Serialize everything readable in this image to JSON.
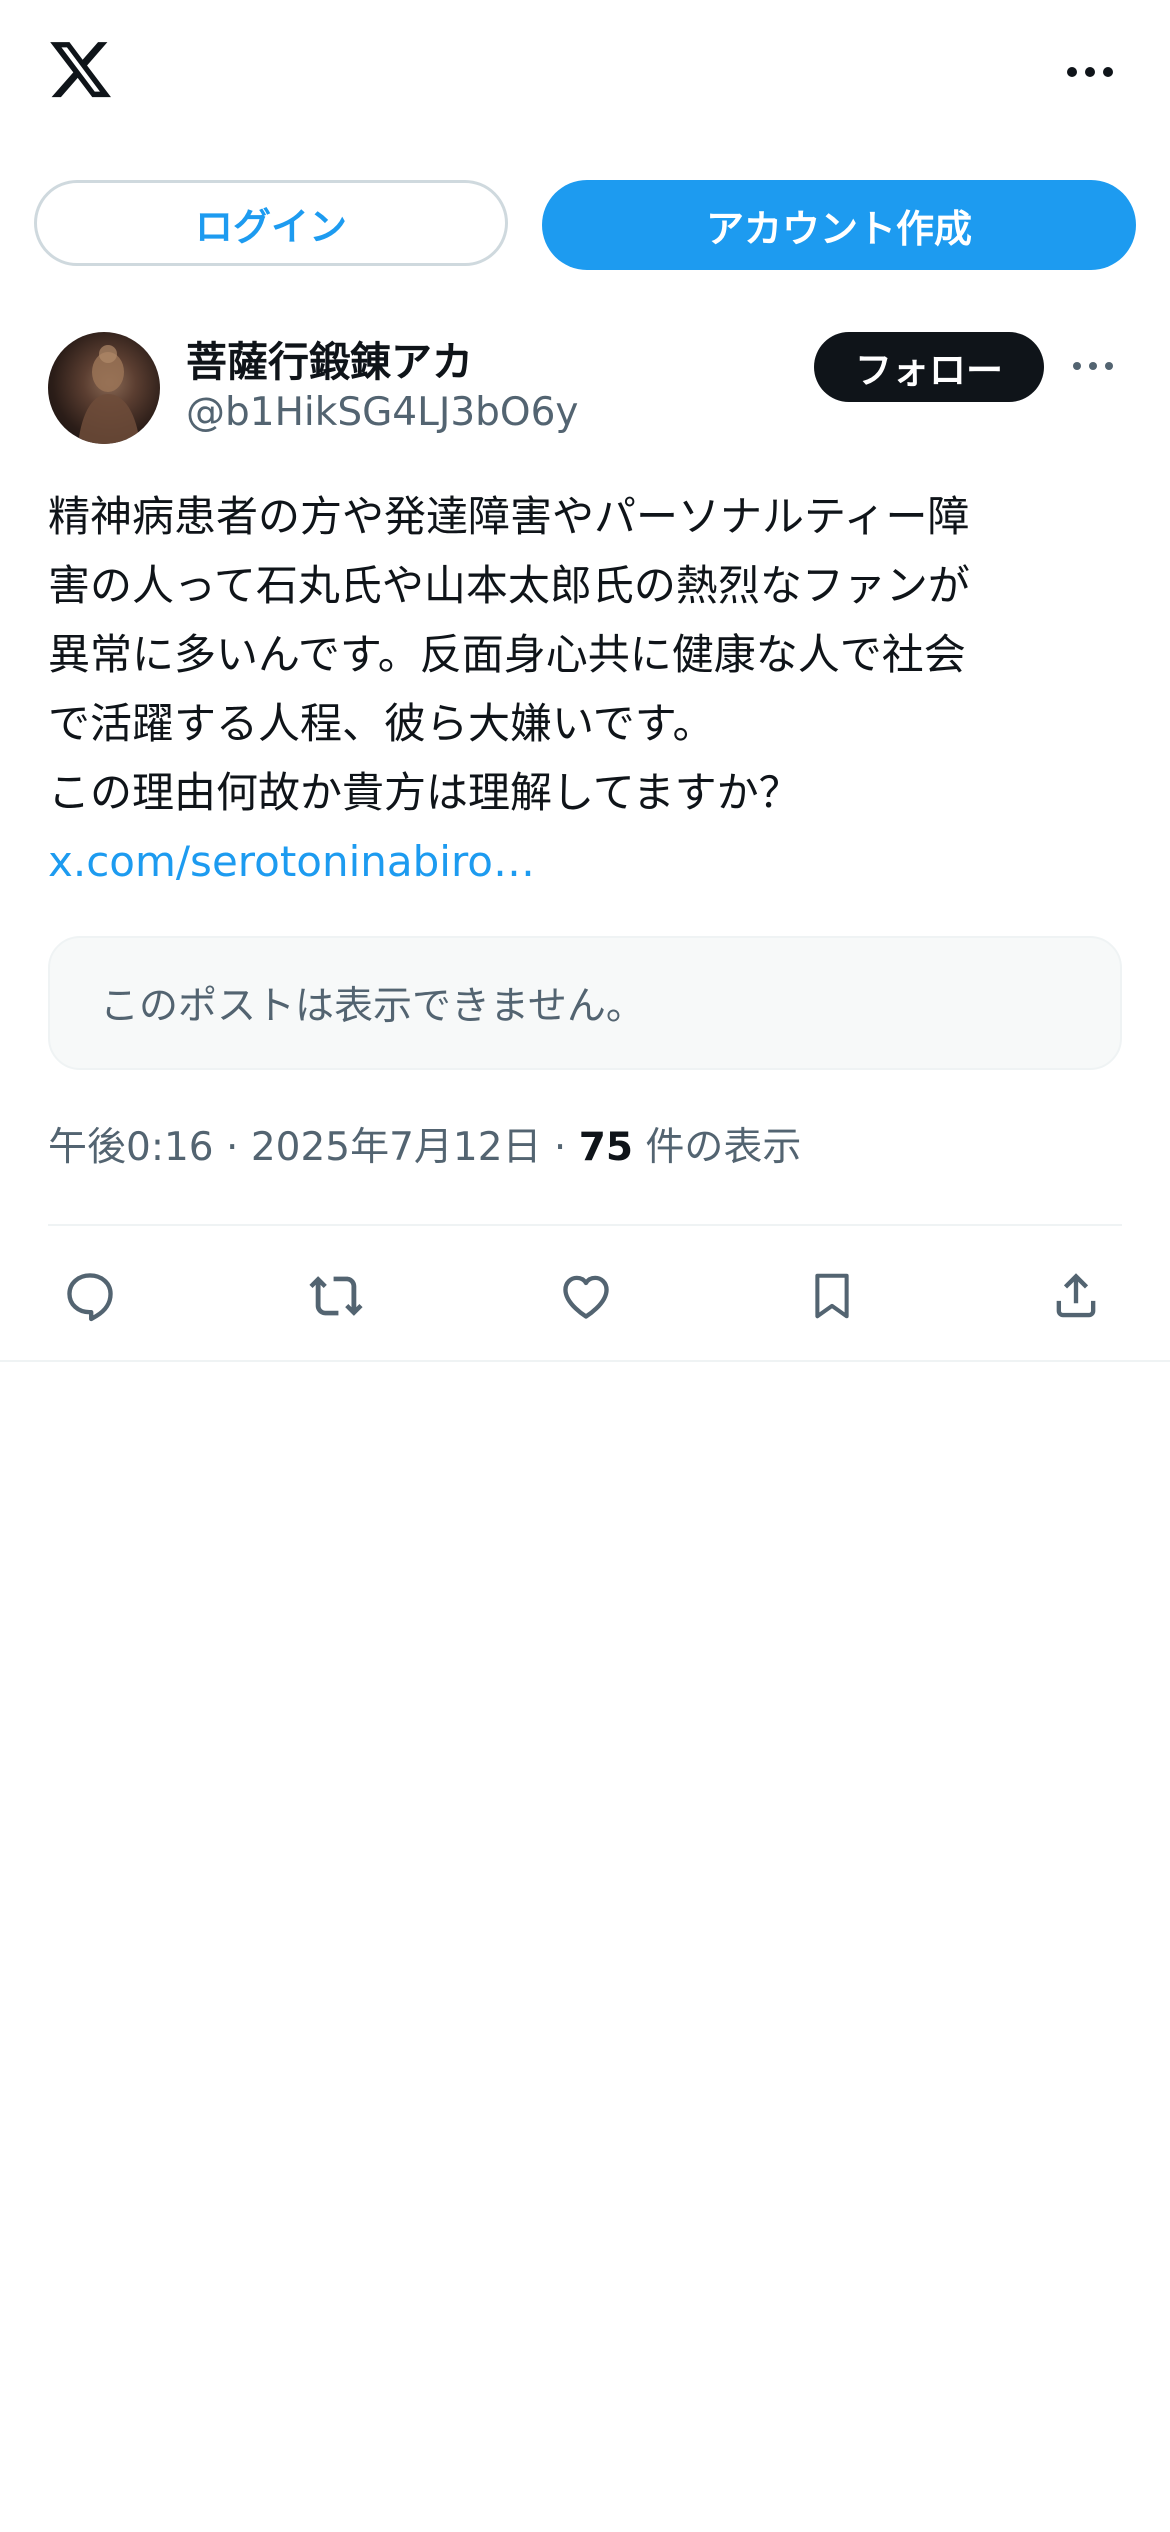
{
  "header": {
    "logo_icon": "x-logo-icon",
    "more_icon": "more-horizontal-icon"
  },
  "auth": {
    "login_label": "ログイン",
    "signup_label": "アカウント作成",
    "accent_color": "#1d9bf0"
  },
  "post": {
    "author": {
      "display_name": "菩薩行鍛錬アカ",
      "handle": "@b1HikSG4LJ3bO6y"
    },
    "follow_label": "フォロー",
    "text_lines": [
      "精神病患者の方や発達障害やパーソナルティー障",
      "害の人って石丸氏や山本太郎氏の熱烈なファンが",
      "異常に多いんです。反面身心共に健康な人で社会",
      "で活躍する人程、彼ら大嫌いです。",
      "この理由何故か貴方は理解してますか？"
    ],
    "link_text": "x.com/serotoninabiro…",
    "quoted_unavailable": "このポストは表示できません。",
    "time": "午後0:16",
    "date": "2025年7月12日",
    "separator": "·",
    "views_count": "75",
    "views_label": "件の表示"
  },
  "actions": [
    {
      "name": "reply",
      "icon": "reply-icon"
    },
    {
      "name": "repost",
      "icon": "repost-icon"
    },
    {
      "name": "like",
      "icon": "heart-icon"
    },
    {
      "name": "bookmark",
      "icon": "bookmark-icon"
    },
    {
      "name": "share",
      "icon": "share-icon"
    }
  ]
}
